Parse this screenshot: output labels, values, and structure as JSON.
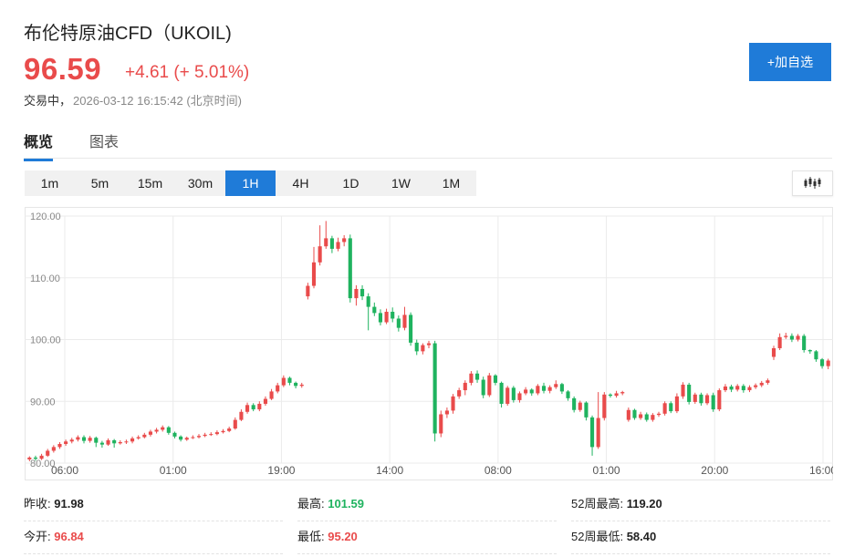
{
  "header": {
    "title": "布伦特原油CFD（UKOIL)",
    "price": "96.59",
    "change": "+4.61 (+ 5.01%)",
    "status": "交易中，",
    "timestamp": "2026-03-12 16:15:42 (北京时间)",
    "watch_button": "+加自选"
  },
  "tabs": [
    "概览",
    "图表"
  ],
  "active_tab": "概览",
  "periods": [
    "1m",
    "5m",
    "15m",
    "30m",
    "1H",
    "4H",
    "1D",
    "1W",
    "1M"
  ],
  "active_period": "1H",
  "chart_type_icon": "candlestick-icon",
  "colors": {
    "up": "#e94b4b",
    "down": "#1fb35f",
    "accent": "#1f7bd8",
    "grid": "#ebebeb"
  },
  "chart_data": {
    "type": "candlestick",
    "ylim": [
      80,
      120
    ],
    "yticks": [
      "120.00",
      "110.00",
      "100.00",
      "90.00",
      "80.00"
    ],
    "xticks": [
      "06:00",
      "01:00",
      "19:00",
      "14:00",
      "08:00",
      "01:00",
      "20:00",
      "16:00"
    ],
    "grid": true,
    "candles": [
      [
        80.6,
        80.9,
        80.3,
        81.1
      ],
      [
        80.9,
        80.7,
        80.4,
        81.2
      ],
      [
        80.7,
        81.2,
        80.5,
        81.5
      ],
      [
        81.2,
        82.0,
        81.0,
        82.3
      ],
      [
        82.0,
        82.6,
        81.7,
        82.9
      ],
      [
        82.6,
        83.1,
        82.3,
        83.4
      ],
      [
        83.1,
        83.5,
        82.8,
        83.8
      ],
      [
        83.5,
        83.8,
        83.2,
        84.1
      ],
      [
        83.8,
        84.2,
        83.5,
        84.5
      ],
      [
        84.2,
        83.6,
        83.2,
        84.5
      ],
      [
        83.6,
        84.1,
        83.3,
        84.4
      ],
      [
        84.1,
        83.3,
        82.6,
        84.3
      ],
      [
        83.3,
        83.0,
        82.5,
        83.6
      ],
      [
        83.0,
        83.7,
        82.8,
        84.0
      ],
      [
        83.7,
        83.2,
        82.5,
        83.9
      ],
      [
        83.2,
        83.4,
        83.0,
        83.7
      ],
      [
        83.4,
        83.5,
        83.1,
        83.8
      ],
      [
        83.5,
        84.0,
        83.2,
        84.3
      ],
      [
        84.0,
        84.2,
        83.8,
        84.5
      ],
      [
        84.2,
        84.6,
        84.0,
        84.9
      ],
      [
        84.6,
        85.1,
        84.3,
        85.4
      ],
      [
        85.1,
        85.4,
        84.8,
        85.7
      ],
      [
        85.4,
        85.8,
        85.1,
        86.1
      ],
      [
        85.8,
        84.9,
        84.6,
        86.0
      ],
      [
        84.9,
        84.3,
        84.0,
        85.1
      ],
      [
        84.3,
        83.8,
        83.5,
        84.5
      ],
      [
        83.8,
        84.1,
        83.6,
        84.3
      ],
      [
        84.1,
        84.2,
        83.9,
        84.5
      ],
      [
        84.2,
        84.4,
        84.0,
        84.7
      ],
      [
        84.4,
        84.6,
        84.2,
        84.9
      ],
      [
        84.6,
        84.7,
        84.4,
        85.0
      ],
      [
        84.7,
        85.0,
        84.5,
        85.3
      ],
      [
        85.0,
        85.2,
        84.8,
        85.5
      ],
      [
        85.2,
        85.6,
        85.0,
        85.9
      ],
      [
        85.6,
        87.0,
        85.4,
        87.4
      ],
      [
        87.0,
        88.3,
        86.8,
        88.7
      ],
      [
        88.3,
        89.4,
        88.0,
        89.8
      ],
      [
        89.4,
        88.7,
        88.4,
        89.7
      ],
      [
        88.7,
        89.6,
        88.4,
        90.0
      ],
      [
        89.6,
        90.4,
        89.3,
        90.8
      ],
      [
        90.4,
        91.6,
        90.2,
        92.0
      ],
      [
        91.6,
        92.6,
        91.3,
        93.0
      ],
      [
        92.6,
        93.8,
        92.3,
        94.2
      ],
      [
        93.8,
        93.0,
        92.6,
        94.0
      ],
      [
        93.0,
        92.5,
        92.1,
        93.2
      ],
      [
        92.5,
        92.7,
        92.2,
        93.0
      ],
      [
        107.0,
        108.7,
        106.5,
        109.2
      ],
      [
        108.7,
        112.5,
        108.3,
        115.0
      ],
      [
        112.5,
        115.1,
        112.0,
        118.5
      ],
      [
        115.1,
        116.4,
        114.7,
        119.2
      ],
      [
        116.4,
        114.7,
        114.0,
        116.8
      ],
      [
        114.7,
        115.8,
        114.3,
        116.5
      ],
      [
        115.8,
        116.4,
        115.1,
        116.9
      ],
      [
        116.4,
        106.7,
        106.0,
        117.0
      ],
      [
        106.7,
        108.2,
        105.5,
        108.8
      ],
      [
        108.2,
        107.0,
        106.4,
        108.8
      ],
      [
        107.0,
        105.3,
        101.5,
        107.5
      ],
      [
        105.3,
        104.3,
        103.8,
        106.0
      ],
      [
        104.3,
        102.8,
        102.3,
        104.9
      ],
      [
        102.8,
        104.5,
        102.5,
        105.0
      ],
      [
        104.5,
        103.4,
        102.8,
        105.2
      ],
      [
        103.4,
        101.9,
        101.3,
        103.9
      ],
      [
        101.9,
        104.0,
        101.5,
        105.3
      ],
      [
        104.0,
        99.5,
        99.0,
        104.4
      ],
      [
        99.5,
        98.1,
        97.5,
        100.0
      ],
      [
        98.1,
        99.1,
        97.6,
        99.4
      ],
      [
        99.1,
        99.4,
        98.6,
        99.8
      ],
      [
        99.4,
        84.8,
        83.5,
        99.8
      ],
      [
        84.8,
        87.9,
        84.2,
        88.5
      ],
      [
        87.9,
        88.5,
        87.3,
        89.0
      ],
      [
        88.5,
        90.8,
        88.0,
        91.2
      ],
      [
        90.8,
        91.8,
        90.4,
        92.2
      ],
      [
        91.8,
        93.0,
        91.0,
        93.4
      ],
      [
        93.0,
        94.5,
        92.6,
        94.9
      ],
      [
        94.5,
        93.5,
        93.0,
        95.0
      ],
      [
        93.5,
        91.0,
        90.5,
        94.0
      ],
      [
        91.0,
        94.2,
        90.7,
        94.6
      ],
      [
        94.2,
        93.0,
        92.6,
        94.4
      ],
      [
        93.0,
        89.6,
        89.0,
        93.2
      ],
      [
        89.6,
        92.2,
        89.3,
        92.5
      ],
      [
        92.2,
        90.2,
        89.8,
        92.5
      ],
      [
        90.2,
        91.3,
        89.8,
        91.6
      ],
      [
        91.3,
        91.9,
        91.0,
        92.3
      ],
      [
        91.9,
        91.3,
        90.9,
        92.1
      ],
      [
        91.3,
        92.5,
        91.0,
        92.8
      ],
      [
        92.5,
        91.7,
        91.3,
        93.0
      ],
      [
        91.7,
        92.3,
        91.3,
        92.6
      ],
      [
        92.3,
        92.8,
        92.0,
        93.4
      ],
      [
        92.8,
        91.6,
        91.2,
        93.0
      ],
      [
        91.6,
        90.5,
        90.1,
        91.8
      ],
      [
        90.5,
        88.6,
        88.2,
        90.8
      ],
      [
        88.6,
        89.8,
        88.3,
        90.1
      ],
      [
        89.8,
        87.4,
        86.9,
        90.0
      ],
      [
        87.4,
        82.6,
        81.2,
        87.7
      ],
      [
        82.6,
        87.3,
        82.3,
        91.5
      ],
      [
        87.3,
        91.1,
        86.9,
        91.5
      ],
      [
        91.1,
        90.9,
        90.6,
        91.3
      ],
      [
        90.9,
        91.3,
        90.6,
        91.7
      ],
      [
        91.3,
        91.5,
        91.0,
        91.7
      ],
      [
        87.0,
        88.6,
        86.7,
        89.0
      ],
      [
        88.6,
        87.3,
        87.0,
        88.8
      ],
      [
        87.3,
        87.9,
        87.0,
        88.3
      ],
      [
        87.9,
        87.0,
        86.7,
        88.2
      ],
      [
        87.0,
        87.8,
        86.7,
        88.1
      ],
      [
        87.8,
        88.0,
        87.5,
        88.3
      ],
      [
        88.0,
        89.7,
        87.7,
        90.0
      ],
      [
        89.7,
        88.4,
        88.1,
        90.0
      ],
      [
        88.4,
        90.8,
        88.1,
        91.3
      ],
      [
        90.8,
        92.7,
        90.4,
        93.1
      ],
      [
        92.7,
        89.9,
        89.5,
        93.0
      ],
      [
        89.9,
        91.1,
        89.6,
        91.4
      ],
      [
        91.1,
        89.7,
        89.3,
        91.4
      ],
      [
        89.7,
        91.0,
        89.4,
        91.3
      ],
      [
        91.0,
        88.7,
        88.3,
        91.4
      ],
      [
        88.7,
        91.8,
        88.4,
        92.1
      ],
      [
        91.8,
        92.4,
        91.5,
        92.8
      ],
      [
        92.4,
        91.9,
        91.5,
        92.7
      ],
      [
        91.9,
        92.5,
        91.6,
        92.8
      ],
      [
        92.5,
        91.8,
        91.4,
        92.8
      ],
      [
        91.8,
        92.3,
        91.5,
        92.6
      ],
      [
        92.3,
        92.6,
        92.0,
        92.9
      ],
      [
        92.6,
        93.0,
        92.3,
        93.3
      ],
      [
        93.0,
        93.4,
        92.7,
        93.7
      ],
      [
        97.2,
        98.6,
        96.7,
        99.0
      ],
      [
        98.6,
        100.4,
        98.3,
        101.0
      ],
      [
        100.4,
        100.6,
        100.1,
        101.1
      ],
      [
        100.6,
        100.0,
        99.6,
        101.0
      ],
      [
        100.0,
        100.6,
        99.7,
        100.9
      ],
      [
        100.6,
        98.3,
        97.9,
        100.9
      ],
      [
        98.3,
        98.1,
        97.7,
        98.4
      ],
      [
        98.1,
        96.8,
        96.4,
        98.3
      ],
      [
        96.8,
        95.7,
        95.3,
        97.0
      ],
      [
        95.7,
        96.6,
        95.2,
        96.9
      ]
    ]
  },
  "stats": {
    "prev_close_label": "昨收:",
    "prev_close": "91.98",
    "high_label": "最高:",
    "high": "101.59",
    "high52_label": "52周最高:",
    "high52": "119.20",
    "open_label": "今开:",
    "open": "96.84",
    "low_label": "最低:",
    "low": "95.20",
    "low52_label": "52周最低:",
    "low52": "58.40"
  }
}
